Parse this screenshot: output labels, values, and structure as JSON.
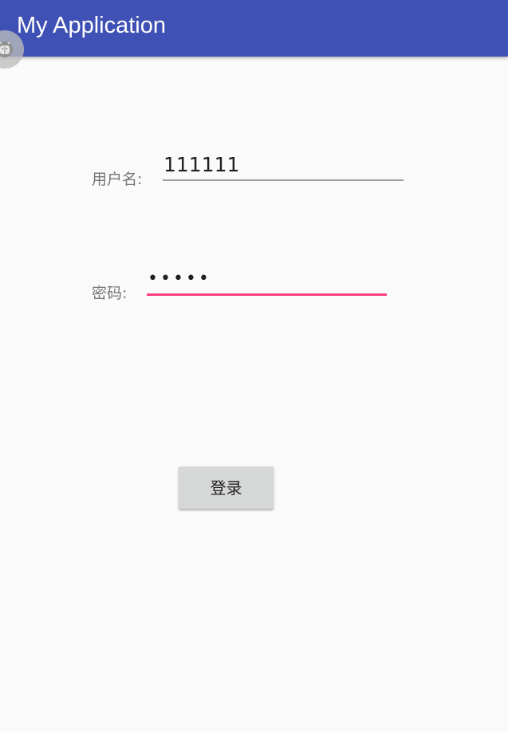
{
  "app_bar": {
    "title": "My Application"
  },
  "floating_debug_icon": {
    "icon": "android-debug-icon",
    "color": "#9e9e9e"
  },
  "form": {
    "username_label": "用户名:",
    "username_value": "111111",
    "password_label": "密码:",
    "password_masked_value": "•••••",
    "submit_label": "登录"
  },
  "colors": {
    "primary": "#3f51b5",
    "accent": "#ff4081",
    "background": "#fafafa",
    "button_background": "#d6d7d7"
  }
}
